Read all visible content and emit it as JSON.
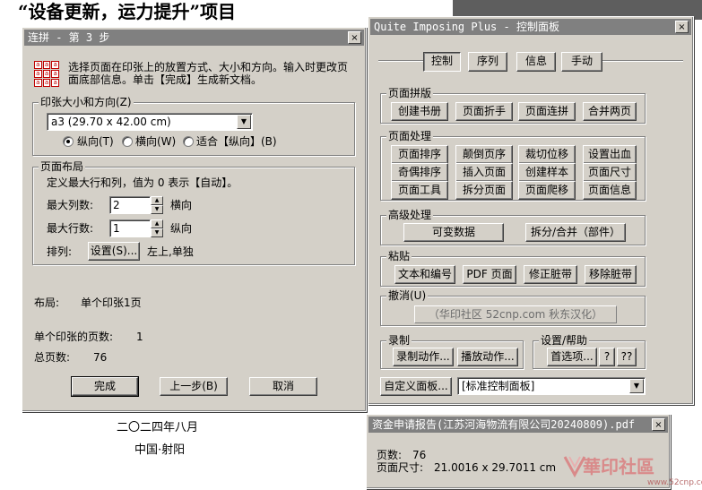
{
  "background": {
    "heading": "“设备更新，运力提升”项目",
    "date": "二〇二四年八月",
    "place": "中国·射阳"
  },
  "wizard": {
    "title": "连拼 - 第 3 步",
    "close": "×",
    "instruction": "选择页面在印张上的放置方式、大小和方向。输入时更改页面底部信息。单击【完成】生成新文档。",
    "icon_cell": "a",
    "sheet_group": "印张大小和方向(Z)",
    "sheet_size": "a3 (29.70 x 42.00 cm)",
    "orient_portrait": "纵向(T)",
    "orient_landscape": "横向(W)",
    "orient_fit": "适合【纵向】(B)",
    "layout_group": "页面布局",
    "layout_hint": "定义最大行和列，值为 0 表示【自动】。",
    "max_cols_label": "最大列数:",
    "max_cols_value": "2",
    "cols_dir": "横向",
    "max_rows_label": "最大行数:",
    "max_rows_value": "1",
    "rows_dir": "纵向",
    "arrange_label": "排列:",
    "arrange_button": "设置(S)...",
    "arrange_value": "左上,单独",
    "layout_label": "布局:",
    "layout_value": "单个印张1页",
    "pages_per_sheet_label": "单个印张的页数:",
    "pages_per_sheet_value": "1",
    "total_pages_label": "总页数:",
    "total_pages_value": "76",
    "finish": "完成",
    "back": "上一步(B)",
    "cancel": "取消"
  },
  "control_panel": {
    "title": "Quite Imposing Plus - 控制面板",
    "close": "×",
    "tabs": [
      "控制",
      "序列",
      "信息",
      "手动"
    ],
    "imposition": {
      "label": "页面拼版",
      "buttons": [
        "创建书册",
        "页面折手",
        "页面连拼",
        "合并两页"
      ]
    },
    "page_processing": {
      "label": "页面处理",
      "buttons": [
        "页面排序",
        "颠倒页序",
        "裁切位移",
        "设置出血",
        "奇偶排序",
        "插入页面",
        "创建样本",
        "页面尺寸",
        "页面工具",
        "拆分页面",
        "页面爬移",
        "页面信息"
      ]
    },
    "advanced": {
      "label": "高级处理",
      "buttons": [
        "可变数据",
        "拆分/合并（部件）"
      ]
    },
    "paste": {
      "label": "粘贴",
      "buttons": [
        "文本和编号",
        "PDF 页面",
        "修正脏带",
        "移除脏带"
      ]
    },
    "undo": {
      "label": "撤消(U)",
      "text": "（华印社区 52cnp.com 秋东汉化）"
    },
    "record": {
      "label": "录制",
      "buttons": [
        "录制动作...",
        "播放动作..."
      ]
    },
    "settings": {
      "label": "设置/帮助",
      "buttons": [
        "首选项...",
        "?",
        "??"
      ]
    },
    "customize_button": "自定义面板...",
    "panel_select": "[标准控制面板]"
  },
  "info_window": {
    "title": "资金申请报告(江苏河海物流有限公司20240809).pdf",
    "close": "×",
    "pages_label": "页数:",
    "pages_value": "76",
    "size_label": "页面尺寸:",
    "size_value": "21.0016 x 29.7011 cm"
  },
  "watermark": {
    "brand": "華印社區",
    "url": "www.52cnp.com"
  },
  "colors": {
    "face": "#d4d0c8",
    "title_inactive": "#808080",
    "watermark": "#d98a8a"
  }
}
